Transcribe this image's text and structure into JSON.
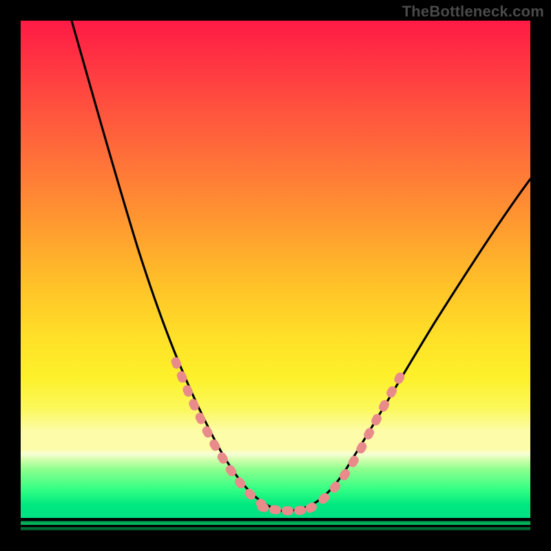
{
  "watermark": "TheBottleneck.com",
  "chart_data": {
    "type": "line",
    "title": "",
    "xlabel": "",
    "ylabel": "",
    "xlim": [
      0,
      100
    ],
    "ylim": [
      0,
      100
    ],
    "grid": false,
    "series": [
      {
        "name": "bottleneck-curve",
        "x": [
          10,
          15,
          20,
          25,
          30,
          35,
          40,
          43,
          47,
          50,
          55,
          58,
          62,
          68,
          75,
          82,
          90,
          100
        ],
        "y": [
          100,
          84,
          70,
          57,
          45,
          34,
          24,
          18,
          10,
          6,
          4,
          4,
          6,
          11,
          19,
          29,
          40,
          55
        ]
      }
    ],
    "thresholds": {
      "pale_yellow_band": [
        80.5,
        84
      ],
      "green_zone_top": 86
    },
    "markers": {
      "comment": "salmon dotted segments overlaid on the curve in lower regions",
      "left_segment_y_range": [
        10,
        32
      ],
      "right_segment_y_range": [
        4,
        30
      ]
    }
  }
}
